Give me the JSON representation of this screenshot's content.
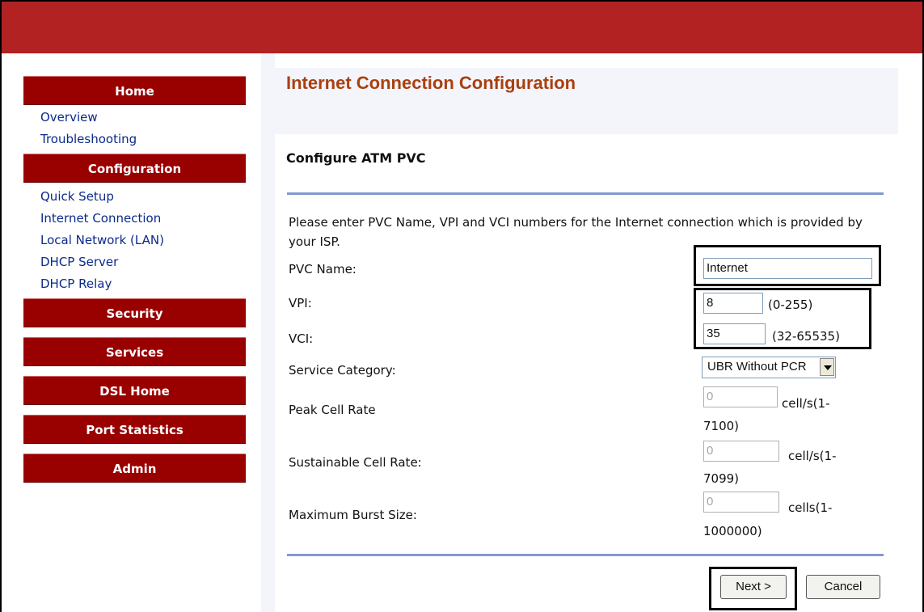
{
  "sidebar": {
    "home": "Home",
    "home_links": [
      "Overview",
      "Troubleshooting"
    ],
    "configuration": "Configuration",
    "config_links": [
      "Quick Setup",
      "Internet Connection",
      "Local Network (LAN)",
      "DHCP Server",
      "DHCP Relay"
    ],
    "security": "Security",
    "services": "Services",
    "dsl_home": "DSL Home",
    "port_statistics": "Port Statistics",
    "admin": "Admin"
  },
  "page": {
    "title": "Internet Connection Configuration",
    "section": "Configure ATM PVC",
    "intro": "Please enter PVC Name, VPI and VCI numbers for the Internet connection which is provided by your ISP."
  },
  "form": {
    "pvc_name_label": "PVC Name:",
    "pvc_name_value": "Internet",
    "vpi_label": "VPI:",
    "vpi_value": "8",
    "vpi_range": "(0-255)",
    "vci_label": "VCI:",
    "vci_value": "35",
    "vci_range": "(32-65535)",
    "service_category_label": "Service Category:",
    "service_category_value": "UBR Without PCR",
    "peak_cell_rate_label": "Peak Cell Rate",
    "peak_cell_rate_value": "0",
    "peak_cell_rate_unit": "cell/s(1-",
    "peak_cell_rate_max": "7100)",
    "sustainable_cell_rate_label": "Sustainable Cell Rate:",
    "sustainable_cell_rate_value": "0",
    "sustainable_cell_rate_unit": "cell/s(1-",
    "sustainable_cell_rate_max": "7099)",
    "max_burst_size_label": "Maximum Burst Size:",
    "max_burst_size_value": "0",
    "max_burst_size_unit": "cells(1-",
    "max_burst_size_max": "1000000)"
  },
  "buttons": {
    "next": "Next >",
    "cancel": "Cancel"
  },
  "colors": {
    "topbar": "#b22222",
    "nav_header": "#990000",
    "title": "#a8400f",
    "rule": "#8199d0",
    "link": "#0b2a8a"
  }
}
